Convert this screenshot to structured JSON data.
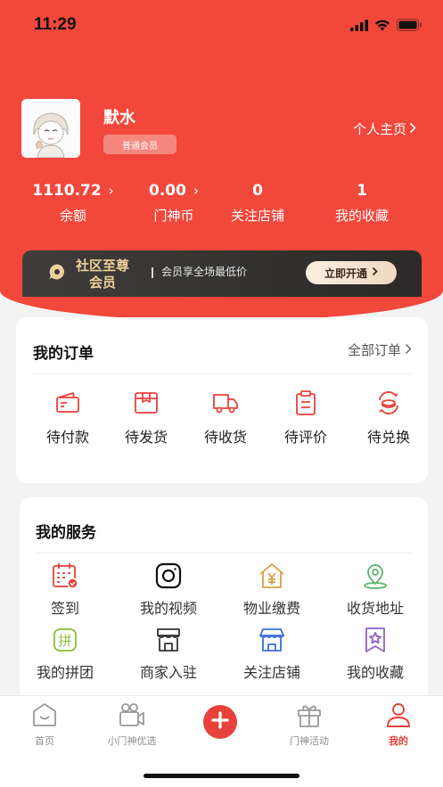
{
  "status_bar": {
    "time": "11:29"
  },
  "profile": {
    "username": "默水",
    "member_level": "普通会员",
    "homepage_link": "个人主页"
  },
  "stats": [
    {
      "value": "1110.72",
      "label": "余额",
      "has_arrow": true
    },
    {
      "value": "0.00",
      "label": "门神币",
      "has_arrow": true
    },
    {
      "value": "0",
      "label": "关注店铺",
      "has_arrow": false
    },
    {
      "value": "1",
      "label": "我的收藏",
      "has_arrow": false
    }
  ],
  "vip": {
    "title_line1": "社区至尊",
    "title_line2": "会员",
    "description": "会员享全场最低价",
    "button": "立即开通"
  },
  "orders": {
    "title": "我的订单",
    "all_link": "全部订单",
    "items": [
      {
        "label": "待付款",
        "icon": "wallet-icon"
      },
      {
        "label": "待发货",
        "icon": "package-icon"
      },
      {
        "label": "待收货",
        "icon": "truck-icon"
      },
      {
        "label": "待评价",
        "icon": "clipboard-icon"
      },
      {
        "label": "待兑换",
        "icon": "exchange-icon"
      }
    ]
  },
  "services": {
    "title": "我的服务",
    "items": [
      {
        "label": "签到",
        "icon": "calendar-check-icon"
      },
      {
        "label": "我的视频",
        "icon": "camera-icon"
      },
      {
        "label": "物业缴费",
        "icon": "house-yen-icon"
      },
      {
        "label": "收货地址",
        "icon": "location-pin-icon"
      },
      {
        "label": "我的拼团",
        "icon": "group-buy-icon"
      },
      {
        "label": "商家入驻",
        "icon": "storefront-icon"
      },
      {
        "label": "关注店铺",
        "icon": "shop-icon"
      },
      {
        "label": "我的收藏",
        "icon": "star-bookmark-icon"
      }
    ]
  },
  "bottom_nav": [
    {
      "label": "首页",
      "icon": "home-icon",
      "active": false
    },
    {
      "label": "小门神优选",
      "icon": "video-camera-icon",
      "active": false
    },
    {
      "label": "",
      "icon": "add-icon",
      "active": false
    },
    {
      "label": "门神活动",
      "icon": "gift-icon",
      "active": false
    },
    {
      "label": "我的",
      "icon": "user-icon",
      "active": true
    }
  ],
  "colors": {
    "brand_red": "#f2473b",
    "accent_red": "#e8413b",
    "vip_gold": "#efcf9a",
    "vip_dark": "#2e2d2c",
    "green_icon": "#5ab56e",
    "orange_icon": "#d9a046",
    "purple_icon": "#8e62c9",
    "blue_icon": "#3a6ed8"
  }
}
